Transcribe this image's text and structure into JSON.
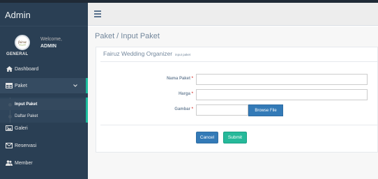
{
  "app": {
    "title": "Admin"
  },
  "profile": {
    "welcome": "Welcome,",
    "name": "ADMIN",
    "avatar_text": "fairuz"
  },
  "sidebar": {
    "section_label": "GENERAL",
    "items": [
      {
        "label": "Dashboard",
        "icon": "home-icon"
      },
      {
        "label": "Paket",
        "icon": "table-icon",
        "expanded": true
      },
      {
        "label": "Galeri",
        "icon": "picture-icon"
      },
      {
        "label": "Reservasi",
        "icon": "envelope-icon"
      },
      {
        "label": "Member",
        "icon": "users-icon"
      }
    ],
    "submenu": [
      {
        "label": "Input Paket",
        "active": true
      },
      {
        "label": "Daftar Paket",
        "active": false
      }
    ]
  },
  "page": {
    "title": "Paket / Input Paket"
  },
  "panel": {
    "title": "Fairuz Wedding Organizer",
    "subtitle": "input paket"
  },
  "form": {
    "nama_label": "Nama Paket",
    "harga_label": "Harga",
    "gambar_label": "Gambar",
    "required_mark": "*",
    "nama_value": "",
    "harga_value": "",
    "gambar_value": "",
    "browse_label": "Browse File",
    "cancel_label": "Cancel",
    "submit_label": "Submit"
  },
  "colors": {
    "sidebar": "#2a3f54",
    "accent": "#1abb9c",
    "primary": "#337ab7",
    "success": "#26b99a"
  }
}
